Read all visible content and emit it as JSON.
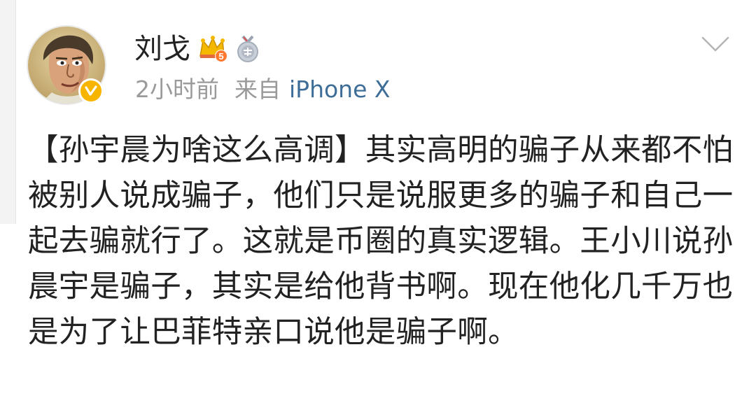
{
  "post": {
    "author": {
      "name": "刘戈",
      "avatar_icon": "avatar-portrait-icon",
      "verified_icon": "verified-v-icon",
      "badges": [
        "crown-vip-level-5-icon",
        "medal-badge-icon"
      ],
      "vip_level": "5"
    },
    "time": "2小时前",
    "source_prefix": "来自",
    "source_device": "iPhone X",
    "menu_icon": "chevron-down-icon",
    "text": "【孙宇晨为啥这么高调】其实高明的骗子从来都不怕被别人说成骗子，他们只是说服更多的骗子和自己一起去骗就行了。这就是币圈的真实逻辑。王小川说孙晨宇是骗子，其实是给他背书啊。现在他化几千万也是为了让巴菲特亲口说他是骗子啊。"
  },
  "colors": {
    "text": "#222222",
    "meta": "#9a9a9a",
    "link": "#3e6e98",
    "verified": "#f7b500",
    "crown": "#f5b800"
  }
}
